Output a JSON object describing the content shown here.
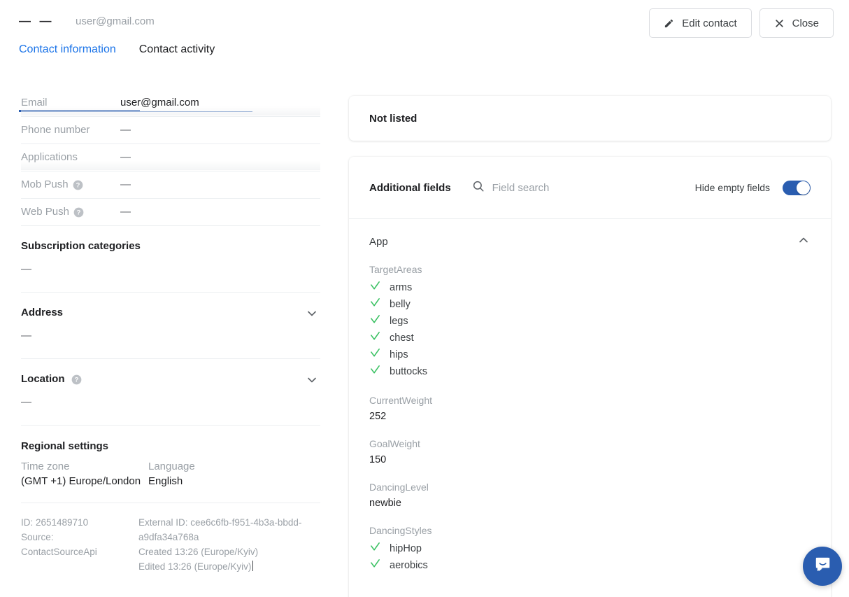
{
  "header": {
    "name_placeholder_1": "—",
    "name_placeholder_2": "—",
    "email": "user@gmail.com",
    "edit_button": "Edit contact",
    "close_button": "Close"
  },
  "tabs": [
    {
      "label": "Contact information",
      "active": true
    },
    {
      "label": "Contact activity",
      "active": false
    }
  ],
  "contact_fields": [
    {
      "label": "Email",
      "value": "user@gmail.com",
      "has_help": false,
      "shaded": true
    },
    {
      "label": "Phone number",
      "value": "—",
      "has_help": false,
      "shaded": false
    },
    {
      "label": "Applications",
      "value": "—",
      "has_help": false,
      "shaded": true
    },
    {
      "label": "Mob Push",
      "value": "—",
      "has_help": true,
      "shaded": false
    },
    {
      "label": "Web Push",
      "value": "—",
      "has_help": true,
      "shaded": false
    }
  ],
  "sections": [
    {
      "title": "Subscription categories",
      "value": "—",
      "has_help": false,
      "has_chevron": false
    },
    {
      "title": "Address",
      "value": "—",
      "has_help": false,
      "has_chevron": true
    },
    {
      "title": "Location",
      "value": "—",
      "has_help": true,
      "has_chevron": true
    }
  ],
  "regional": {
    "title": "Regional settings",
    "timezone_label": "Time zone",
    "timezone_value": "(GMT +1) Europe/London",
    "language_label": "Language",
    "language_value": "English"
  },
  "meta": {
    "id": "ID: 2651489710",
    "source_label": "Source:",
    "source_value": "ContactSourceApi",
    "external_id": "External ID: cee6c6fb-f951-4b3a-bbdd-a9dfa34a768a",
    "created": "Created 13:26 (Europe/Kyiv)",
    "edited": "Edited 13:26 (Europe/Kyiv)"
  },
  "not_listed": {
    "title": "Not listed"
  },
  "additional_fields": {
    "title": "Additional fields",
    "search_placeholder": "Field search",
    "search_value": "",
    "toggle_label": "Hide empty fields",
    "toggle_on": true,
    "group": {
      "name": "App",
      "expanded": true,
      "attributes": [
        {
          "key": "TargetAreas",
          "type": "checklist",
          "items": [
            "arms",
            "belly",
            "legs",
            "chest",
            "hips",
            "buttocks"
          ]
        },
        {
          "key": "CurrentWeight",
          "type": "text",
          "value": "252"
        },
        {
          "key": "GoalWeight",
          "type": "text",
          "value": "150"
        },
        {
          "key": "DancingLevel",
          "type": "text",
          "value": "newbie"
        },
        {
          "key": "DancingStyles",
          "type": "checklist",
          "items": [
            "hipHop",
            "aerobics"
          ]
        }
      ]
    }
  },
  "chat": {
    "tooltip": "Open chat"
  },
  "colors": {
    "accent_blue": "#2a5db0",
    "link_blue": "#1a73e8",
    "check_green": "#3ac162",
    "text_primary": "#202124",
    "text_muted": "#9aa0a6",
    "divider": "#eceff1"
  }
}
